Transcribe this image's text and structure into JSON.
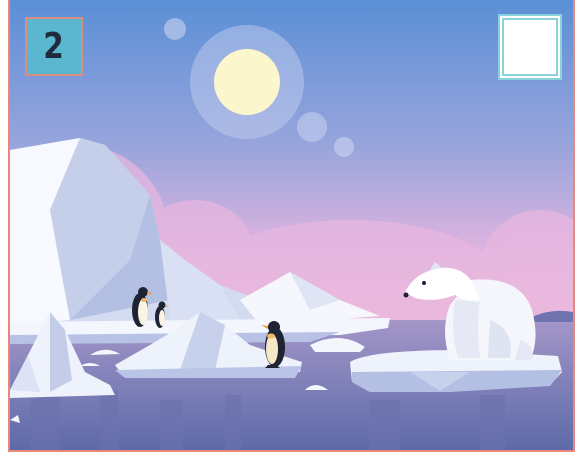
{
  "game": {
    "level_number": "2",
    "answer_box_value": ""
  },
  "scene": {
    "icons": [
      "sun-icon",
      "iceberg-icon",
      "penguin-icon",
      "polar-bear-icon",
      "ice-floe-icon"
    ],
    "colors": {
      "sky_top": "#5b8fd6",
      "sky_bottom": "#f0b8d8",
      "water": "#7d7fb8",
      "ice": "#eef2fb",
      "badge": "#5bb7cf",
      "frame": "#e8877c"
    }
  }
}
